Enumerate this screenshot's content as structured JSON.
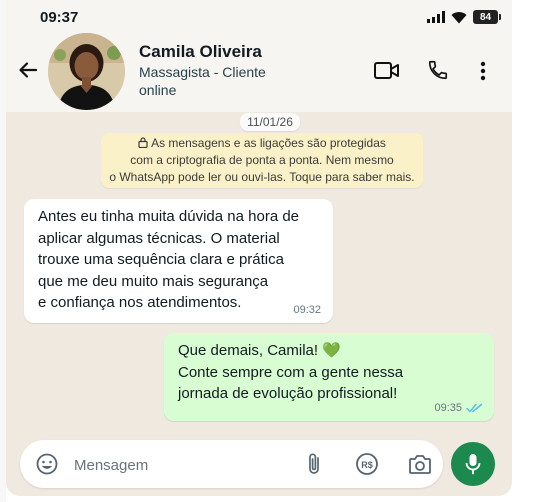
{
  "status_bar": {
    "time": "09:37",
    "battery": "84"
  },
  "contact": {
    "name": "Camila Oliveira",
    "subtitle": "Massagista - Cliente",
    "status": "online"
  },
  "chat": {
    "date": "11/01/26",
    "encryption_notice": "As mensagens e as ligações são protegidas\ncom a criptografia de ponta a ponta. Nem mesmo\no WhatsApp pode ler ou ouvi-las. Toque para saber mais.",
    "messages": [
      {
        "direction": "incoming",
        "text": "Antes eu tinha muita dúvida na hora de\naplicar algumas técnicas. O material\ntrouxe uma sequência clara e prática\nque me deu muito mais segurança\ne confiança nos atendimentos.",
        "time": "09:32"
      },
      {
        "direction": "outgoing",
        "text": "Que demais, Camila! 💚\nConte sempre com a gente nessa\njornada de evolução profissional!",
        "time": "09:35",
        "read": true
      }
    ]
  },
  "composer": {
    "placeholder": "Mensagem"
  },
  "icons": {
    "back": "arrow-left-icon",
    "video": "video-call-icon",
    "call": "phone-icon",
    "menu": "more-vert-icon",
    "emoji": "emoji-icon",
    "attach": "paperclip-icon",
    "payment": "rs-payment-icon",
    "camera": "camera-icon",
    "mic": "mic-icon"
  },
  "colors": {
    "outgoing_bubble": "#d9fdd3",
    "incoming_bubble": "#ffffff",
    "mic_button": "#1c8a4e",
    "encryption_bg": "#fbf1c9",
    "read_ticks": "#53bdeb",
    "heart": "#1fa845"
  }
}
